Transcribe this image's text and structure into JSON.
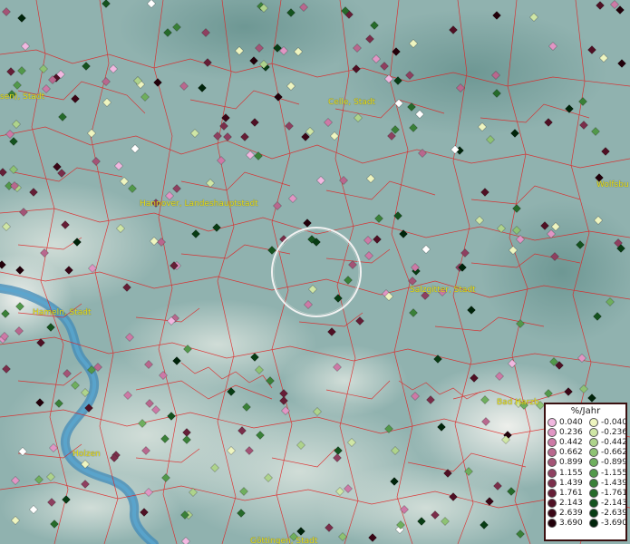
{
  "map": {
    "cities": [
      {
        "name": "Celle, Stadt"
      },
      {
        "name": "Hannover, Landeshauptstadt"
      },
      {
        "name": "Salzgitter, Stadt"
      },
      {
        "name": "Hameln, Stadt"
      },
      {
        "name": "Wolfsbu"
      },
      {
        "name": "sen), Stadt"
      },
      {
        "name": "Bad Harzb"
      },
      {
        "name": "Göttingen, Stadt"
      },
      {
        "name": "Holzen"
      }
    ]
  },
  "legend": {
    "title": "%/Jahr",
    "positive": [
      {
        "label": "0.040",
        "color": "#f0b8e0"
      },
      {
        "label": "0.236",
        "color": "#e096c4"
      },
      {
        "label": "0.442",
        "color": "#cc7aa6"
      },
      {
        "label": "0.662",
        "color": "#b8688e"
      },
      {
        "label": "0.899",
        "color": "#a35476"
      },
      {
        "label": "1.155",
        "color": "#8e4060"
      },
      {
        "label": "1.439",
        "color": "#7a2e4a"
      },
      {
        "label": "1.761",
        "color": "#651e36"
      },
      {
        "label": "2.143",
        "color": "#4f1024"
      },
      {
        "label": "2.639",
        "color": "#3a0616"
      },
      {
        "label": "3.690",
        "color": "#22000a"
      }
    ],
    "negative": [
      {
        "label": "-0.040",
        "color": "#eef5c0"
      },
      {
        "label": "-0.236",
        "color": "#cfe6a6"
      },
      {
        "label": "-0.442",
        "color": "#aed38c"
      },
      {
        "label": "-0.662",
        "color": "#8ec274"
      },
      {
        "label": "-0.899",
        "color": "#6fae5e"
      },
      {
        "label": "-1.155",
        "color": "#52984a"
      },
      {
        "label": "-1.439",
        "color": "#3a8038"
      },
      {
        "label": "-1.761",
        "color": "#266a2a"
      },
      {
        "label": "-2.143",
        "color": "#14521e"
      },
      {
        "label": "-2.639",
        "color": "#083c14"
      },
      {
        "label": "-3.690",
        "color": "#00240a"
      }
    ]
  }
}
